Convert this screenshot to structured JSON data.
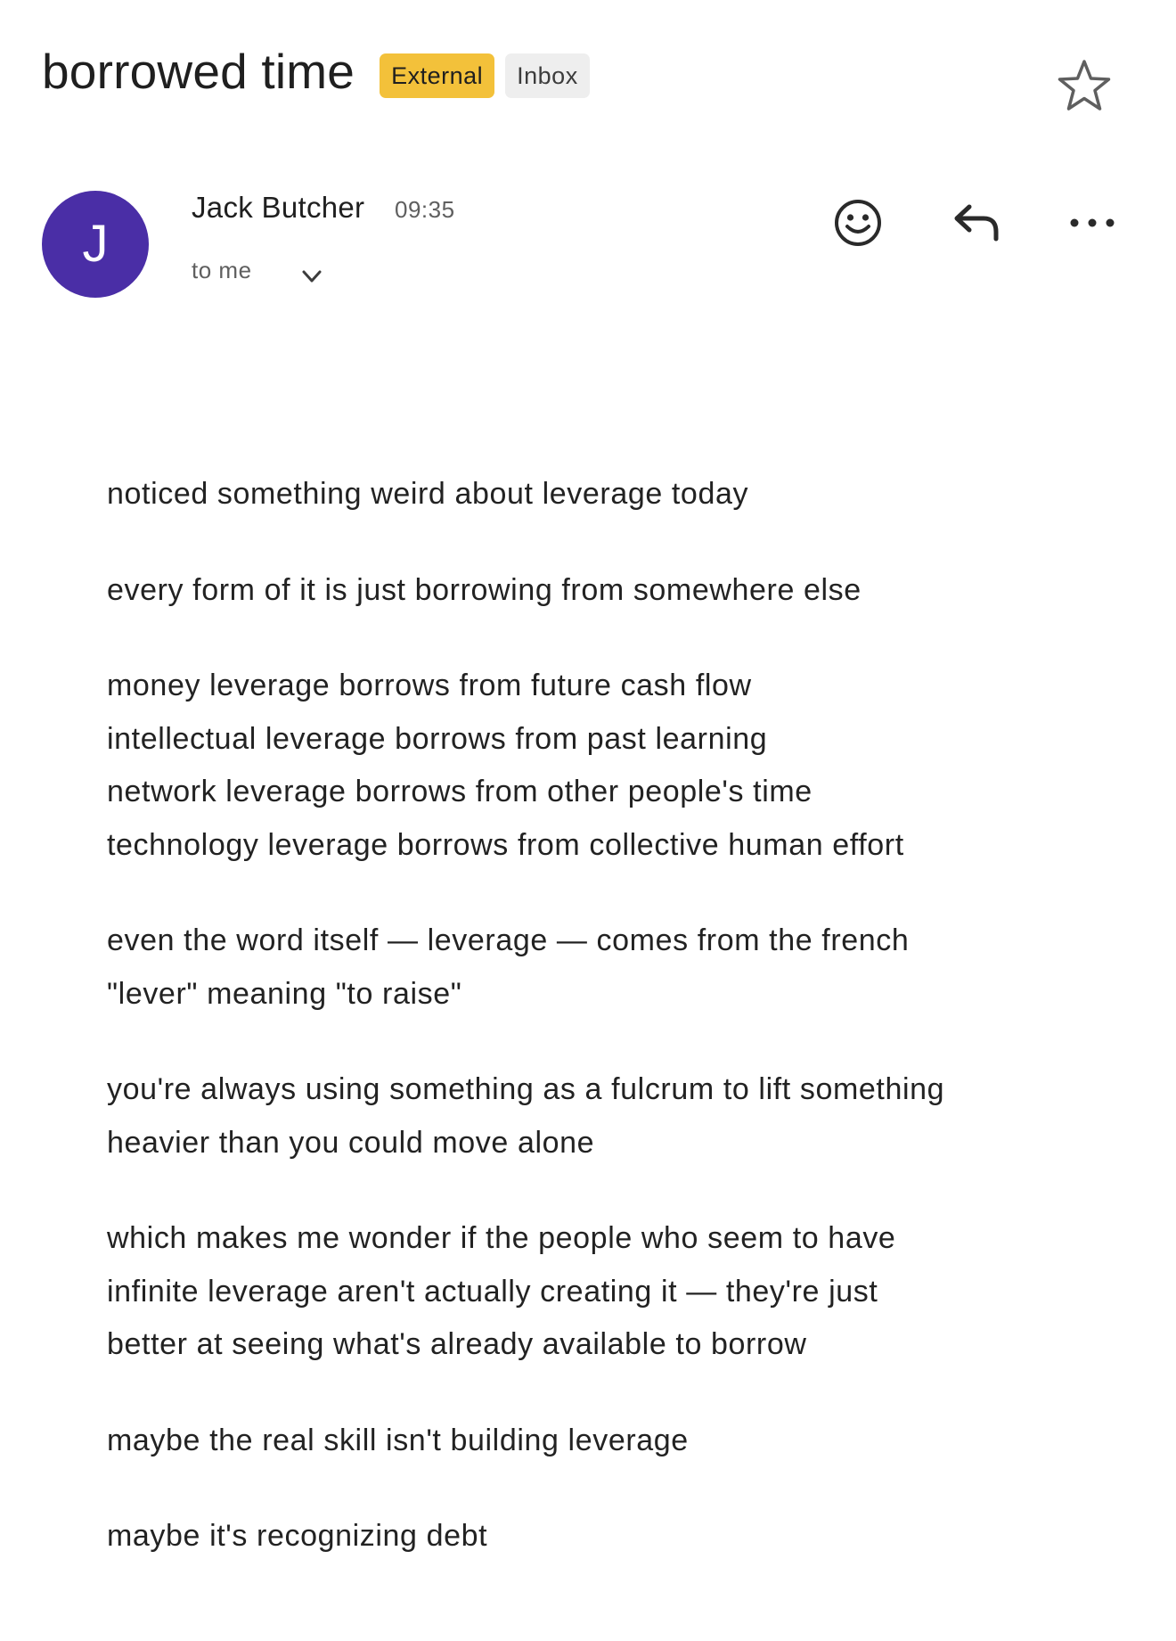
{
  "email": {
    "subject": "borrowed time",
    "labels": {
      "external": "External",
      "inbox": "Inbox"
    },
    "sender": {
      "initial": "J",
      "name": "Jack Butcher",
      "time": "09:35",
      "recipient": "to me",
      "avatar_color": "#4a2ea6"
    },
    "body": {
      "p1": [
        "noticed something weird about leverage today"
      ],
      "p2": [
        "every form of it is just borrowing from somewhere else"
      ],
      "p3": [
        "money leverage borrows from future cash flow",
        "intellectual leverage borrows from past learning",
        "network leverage borrows from other people's time",
        "technology leverage borrows from collective human effort"
      ],
      "p4": [
        "even the word itself — leverage — comes from the french",
        "\"lever\" meaning \"to raise\""
      ],
      "p5": [
        "you're always using something as a fulcrum to lift something",
        "heavier than you could move alone"
      ],
      "p6": [
        "which makes me wonder if the people who seem to have",
        "infinite leverage aren't actually creating it — they're just",
        "better at seeing what's already available to borrow"
      ],
      "p7": [
        "maybe the real skill isn't building leverage"
      ],
      "p8": [
        "maybe it's recognizing debt"
      ]
    }
  },
  "icons": {
    "star": "star-outline-icon",
    "emoji": "emoji-smile-icon",
    "reply": "reply-arrow-icon",
    "more": "more-horizontal-icon",
    "expand": "chevron-down-icon"
  },
  "colors": {
    "external_label": "#f3c13a",
    "inbox_label": "#eeeeee"
  }
}
